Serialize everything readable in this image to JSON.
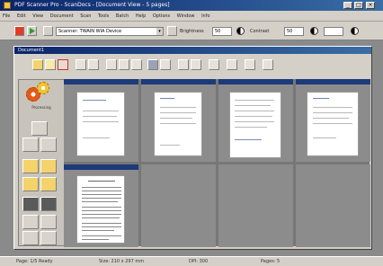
{
  "window": {
    "title": "PDF Scanner Pro - ScanDocs - [Document View - 5 pages]"
  },
  "menu": [
    "File",
    "Edit",
    "View",
    "Document",
    "Scan",
    "Tools",
    "Batch",
    "Help",
    "Options",
    "Window",
    "Info"
  ],
  "toolbar": {
    "scanner_combo": "Scanner: TWAIN WIA Device",
    "brightness_label": "Brightness",
    "brightness_value": "50",
    "contrast_label": "Contrast",
    "contrast_value": "50"
  },
  "doc_window": {
    "title": "Document1"
  },
  "left_panel": {
    "gear_label": "Processing"
  },
  "status": {
    "left": "Page: 1/5 Ready",
    "mid": "Size: 210 x 297 mm",
    "right1": "DPI: 300",
    "right2": "Pages: 5"
  },
  "pages": [
    1,
    2,
    3,
    4,
    5
  ],
  "colors": {
    "title_bar": "#0a246a",
    "cell_header": "#1d3a7a",
    "workspace": "#8a8a8a"
  }
}
